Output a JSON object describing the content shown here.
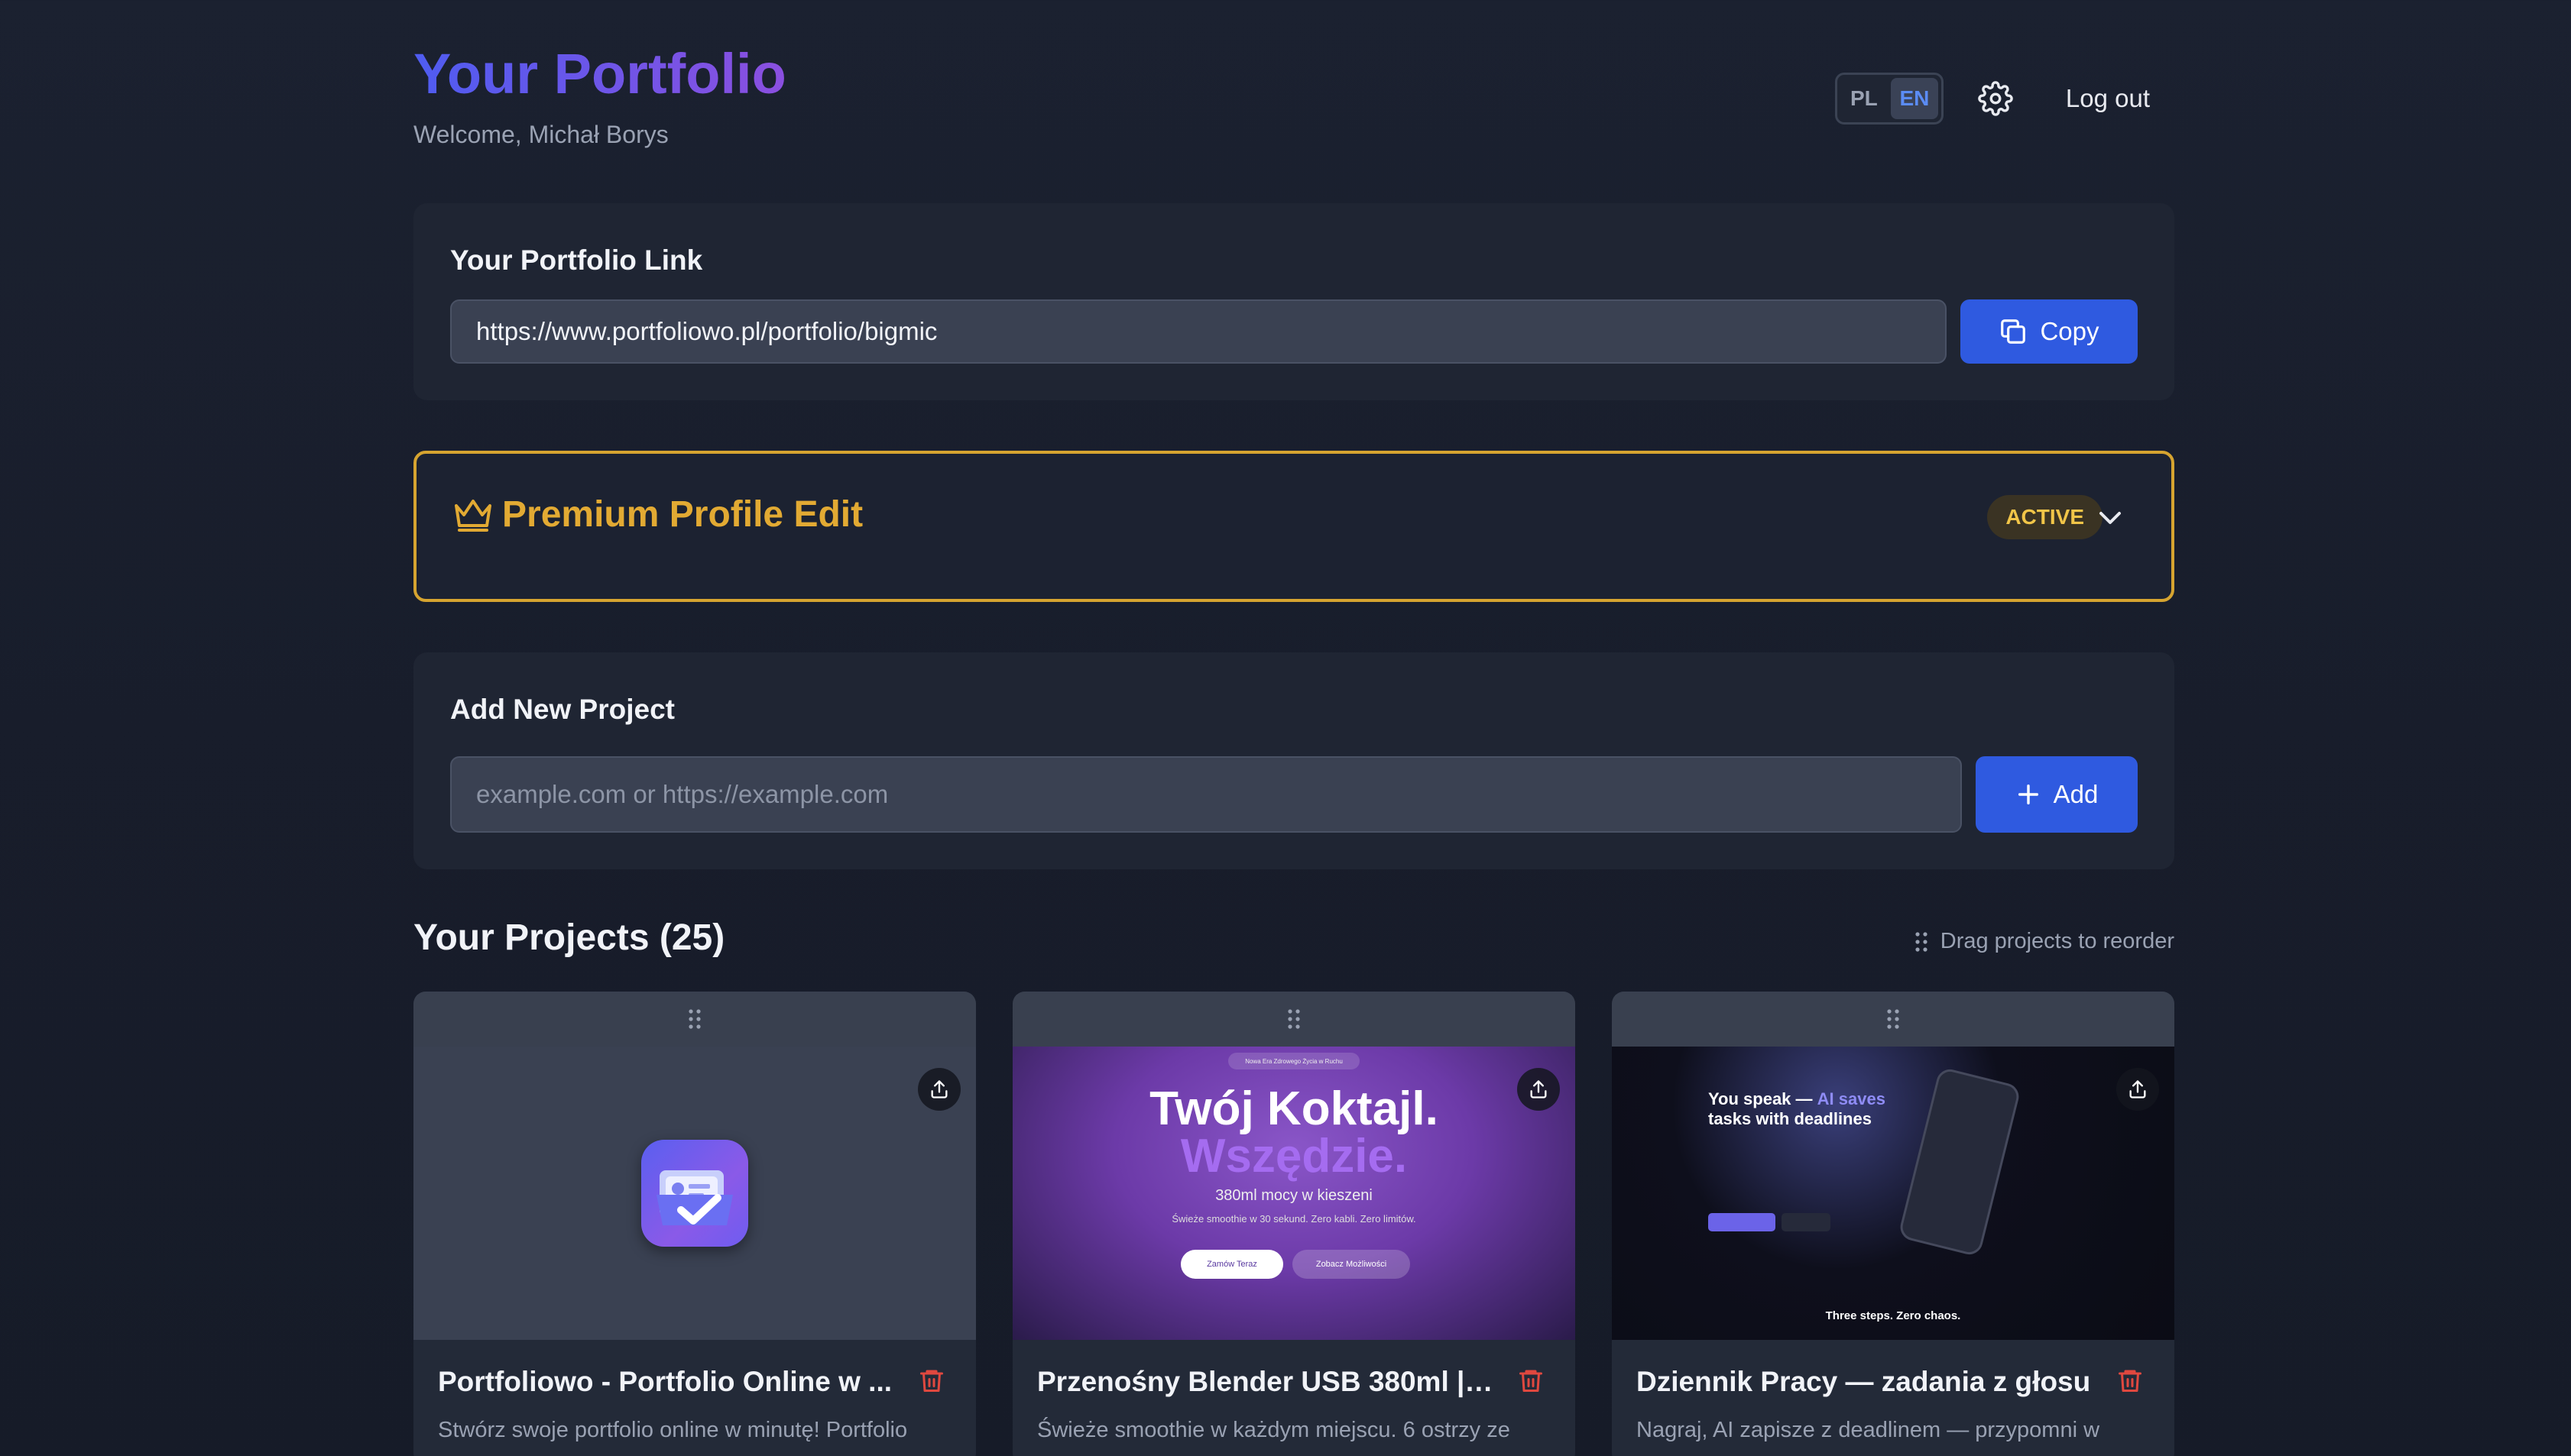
{
  "header": {
    "title": "Your Portfolio",
    "welcome": "Welcome, Michał Borys",
    "lang_pl": "PL",
    "lang_en": "EN",
    "logout": "Log out"
  },
  "link_card": {
    "title": "Your Portfolio Link",
    "url": "https://www.portfoliowo.pl/portfolio/bigmic",
    "copy_label": "Copy"
  },
  "premium": {
    "title": "Premium Profile Edit",
    "badge": "ACTIVE"
  },
  "add_project": {
    "title": "Add New Project",
    "placeholder": "example.com or https://example.com",
    "add_label": "Add"
  },
  "projects": {
    "title": "Your Projects (25)",
    "reorder_hint": "Drag projects to reorder",
    "items": [
      {
        "name": "Portfoliowo - Portfolio Online w ...",
        "desc": "Stwórz swoje portfolio online w minutę! Portfolio"
      },
      {
        "name": "Przenośny Blender USB 380ml | ...",
        "desc": "Świeże smoothie w każdym miejscu. 6 ostrzy ze",
        "preview": {
          "top": "Nowa Era Zdrowego Życia w Ruchu",
          "line1": "Twój Koktajl.",
          "line2": "Wszędzie.",
          "line3": "380ml mocy w kieszeni",
          "line4": "Świeże smoothie w 30 sekund. Zero kabli. Zero limitów.",
          "btn1": "Zamów Teraz",
          "btn2": "Zobacz Możliwości"
        }
      },
      {
        "name": "Dziennik Pracy — zadania z głosu",
        "desc": "Nagraj, AI zapisze z deadlinem — przypomni w",
        "preview": {
          "heading_a": "You speak —",
          "heading_b": "AI saves",
          "heading_c": "tasks with deadlines",
          "bottom": "Three steps. Zero chaos."
        }
      }
    ]
  },
  "colors": {
    "accent": "#2f5ae0",
    "premium": "#e2aa33",
    "danger": "#e0483f"
  }
}
